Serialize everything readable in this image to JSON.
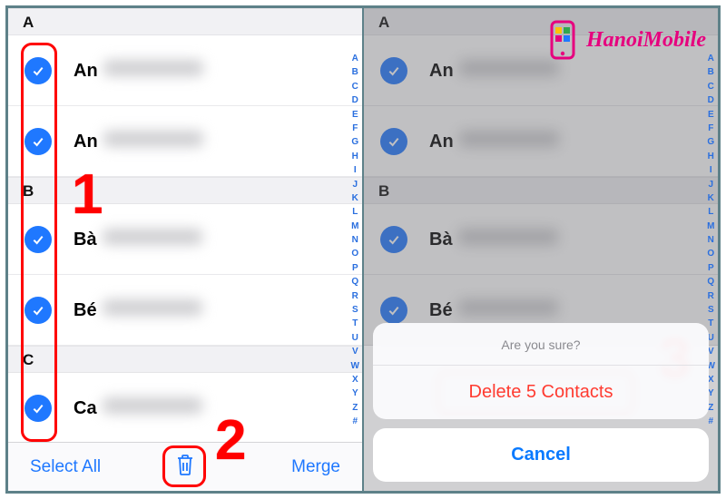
{
  "brand": {
    "name": "HanoiMobile"
  },
  "left": {
    "sections": [
      {
        "letter": "A",
        "rows": [
          {
            "prefix": "An"
          },
          {
            "prefix": "An"
          }
        ]
      },
      {
        "letter": "B",
        "rows": [
          {
            "prefix": "Bà"
          },
          {
            "prefix": "Bé"
          }
        ]
      },
      {
        "letter": "C",
        "rows": [
          {
            "prefix": "Ca"
          }
        ]
      }
    ],
    "toolbar": {
      "select_all": "Select All",
      "merge": "Merge"
    }
  },
  "right": {
    "sections": [
      {
        "letter": "A",
        "rows": [
          {
            "prefix": "An"
          },
          {
            "prefix": "An"
          }
        ]
      },
      {
        "letter": "B",
        "rows": [
          {
            "prefix": "Bà"
          },
          {
            "prefix": "Bé"
          }
        ]
      }
    ],
    "sheet": {
      "title": "Are you sure?",
      "delete": "Delete 5 Contacts",
      "cancel": "Cancel"
    }
  },
  "index_letters": [
    "A",
    "B",
    "C",
    "D",
    "E",
    "F",
    "G",
    "H",
    "I",
    "J",
    "K",
    "L",
    "M",
    "N",
    "O",
    "P",
    "Q",
    "R",
    "S",
    "T",
    "U",
    "V",
    "W",
    "X",
    "Y",
    "Z",
    "#"
  ],
  "annotations": {
    "n1": "1",
    "n2": "2",
    "n3": "3"
  }
}
